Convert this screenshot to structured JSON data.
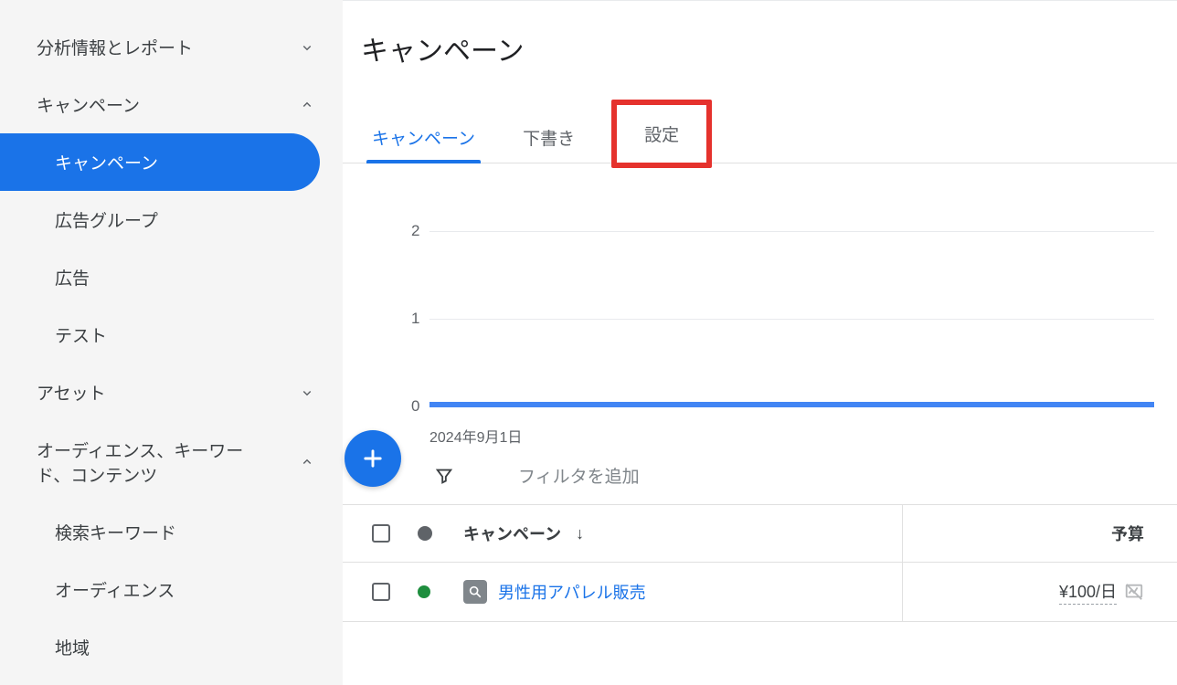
{
  "sidebar": {
    "items": [
      {
        "label": "分析情報とレポート",
        "expanded": false
      },
      {
        "label": "キャンペーン",
        "expanded": true,
        "children": [
          {
            "label": "キャンペーン",
            "active": true
          },
          {
            "label": "広告グループ"
          },
          {
            "label": "広告"
          },
          {
            "label": "テスト"
          }
        ]
      },
      {
        "label": "アセット",
        "expanded": false
      },
      {
        "label": "オーディエンス、キーワード、コンテンツ",
        "expanded": true,
        "children": [
          {
            "label": "検索キーワード"
          },
          {
            "label": "オーディエンス"
          },
          {
            "label": "地域"
          }
        ]
      }
    ]
  },
  "header": {
    "title": "キャンペーン"
  },
  "tabs": [
    {
      "label": "キャンペーン",
      "active": true
    },
    {
      "label": "下書き"
    },
    {
      "label": "設定",
      "highlighted": true
    }
  ],
  "chart_data": {
    "type": "line",
    "x_start_label": "2024年9月1日",
    "y_ticks": [
      0,
      1,
      2
    ],
    "series": [
      {
        "name": "",
        "values": [
          0
        ]
      }
    ]
  },
  "filter": {
    "placeholder": "フィルタを追加"
  },
  "table": {
    "columns": {
      "campaign": "キャンペーン",
      "budget": "予算"
    },
    "rows": [
      {
        "status": "green",
        "icon": "search",
        "name": "男性用アパレル販売",
        "budget": "¥100/日"
      }
    ]
  },
  "chart_y": {
    "t0": "0",
    "t1": "1",
    "t2": "2"
  }
}
